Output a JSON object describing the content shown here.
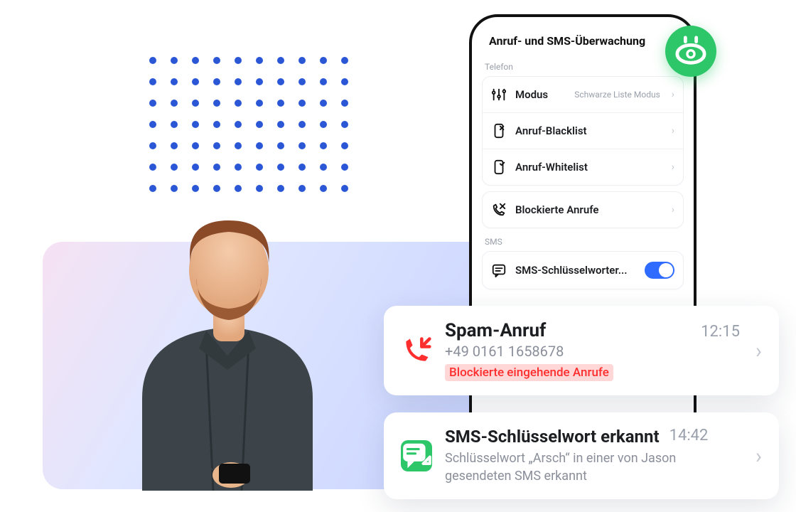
{
  "phone": {
    "title": "Anruf- und SMS-Überwachung",
    "section_telefon": "Telefon",
    "section_sms": "SMS",
    "mode": {
      "label": "Modus",
      "value": "Schwarze Liste Modus"
    },
    "blacklist": {
      "label": "Anruf-Blacklist"
    },
    "whitelist": {
      "label": "Anruf-Whitelist"
    },
    "blocked": {
      "label": "Blockierte Anrufe"
    },
    "sms_keywords": {
      "label": "SMS-Schlüsselworter..."
    }
  },
  "spam": {
    "title": "Spam-Anruf",
    "number": "+49 0161 1658678",
    "badge": "Blockierte eingehende Anrufe",
    "time": "12:15"
  },
  "sms_notif": {
    "title": "SMS-Schlüsselwort erkannt",
    "time": "14:42",
    "desc": "Schlüsselwort „Arsch“ in einer von Jason gesendeten SMS erkannt"
  }
}
